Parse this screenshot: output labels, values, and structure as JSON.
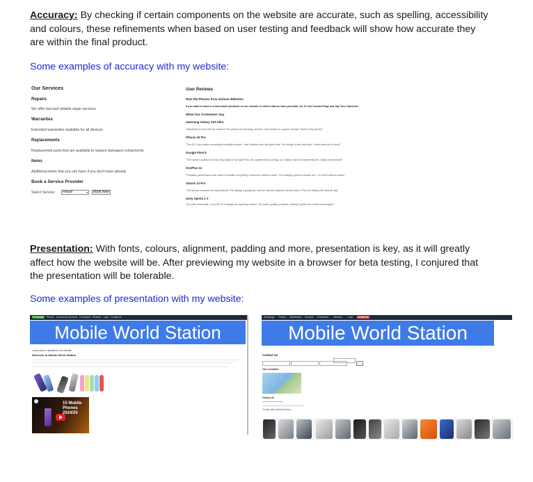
{
  "accuracy": {
    "heading": "Accuracy:",
    "body": " By checking if certain components on the website are accurate, such as spelling, accessibility and colours, these refinements when based on user testing and feedback will show how accurate they are within the final product.",
    "examples": "Some examples of accuracy with my website:"
  },
  "services": {
    "title": "Our Services",
    "items": [
      {
        "name": "Repairs",
        "desc": "We offer fast and reliable repair services"
      },
      {
        "name": "Warranties",
        "desc": "Extended warranties available for all devices."
      },
      {
        "name": "Replacements",
        "desc": "Replacement parts that are available to replace damaged components"
      },
      {
        "name": "Items",
        "desc": "Additional items that you can have if you don't have already"
      }
    ],
    "book_title": "Book a Service Provider",
    "select_label": "Select Service:",
    "select_value": "Repair",
    "book_button": "Book Now"
  },
  "reviews": {
    "title": "User Reviews",
    "rate_title": "Rate the Phones from Various Websites",
    "rate_note": "If you want to leave a review about products on our website or others that we have provided, Go To Our Contact Page and Say Your Opinions!",
    "customers_title": "What Our Customers Say",
    "items": [
      {
        "phone": "Samsung Galaxy S23 Ultra",
        "text": "\"Absolutely in love with the camera! The photos are stunning, and the zoom feature is a game changer. Worth every penny!\""
      },
      {
        "phone": "iPhone 15 Pro",
        "text": "\"The A17 chip makes everything incredibly smooth. I can't believe how fast apps load! The design is also top-notch - feels premium in hand.\""
      },
      {
        "phone": "Google Pixel 8",
        "text": "\"The camera quality is unreal, especially in low light! Plus, the updates keep coming, so I always have the latest features. Highly recommend!\""
      },
      {
        "phone": "OnePlus 11",
        "text": "\"Fantastic performance and value! It handles everything I throw at it without a hitch. The charging speed is insane too - I'm never without power!\""
      },
      {
        "phone": "Xiaomi 13 Pro",
        "text": "\"This phone exceeds my expectations! The display is gorgeous, and the camera captures vibrant colors. Plus, the battery life lasts all day.\""
      },
      {
        "phone": "Sony Xperia 1 V",
        "text": "\"As a film enthusiast, I love the 21:9 display for watching movies. The audio quality is superb, making it perfect for media consumption.\""
      }
    ]
  },
  "presentation": {
    "heading": "Presentation:",
    "body": " With fonts, colours, alignment, padding and more, presentation is key, as it will greatly affect how the website will be. After previewing my website in a browser for beta testing, I conjured that the presentation will be tolerable.",
    "examples": "Some examples of presentation with my website:"
  },
  "site": {
    "banner": "Mobile World Station",
    "nav": [
      "Homepage",
      "Phones",
      "Accessories",
      "Services",
      "Promotions",
      "Reviews",
      "Loan",
      "Contact Us"
    ],
    "home_note": "Lorem Ipsum: Updated to our website",
    "welcome": "Welcome to Mobile World Station",
    "promo_caption": "15 Mobile Phones 2024/25",
    "contact_title": "Contact Us",
    "location_title": "Our Location",
    "follow_title": "Follow Us",
    "footer_link": "Contact With Mobile Reviews"
  },
  "colors": {
    "accent_blue": "#1c2bd4",
    "banner_blue": "#3f7be8",
    "nav_dark": "#1f2a36"
  }
}
